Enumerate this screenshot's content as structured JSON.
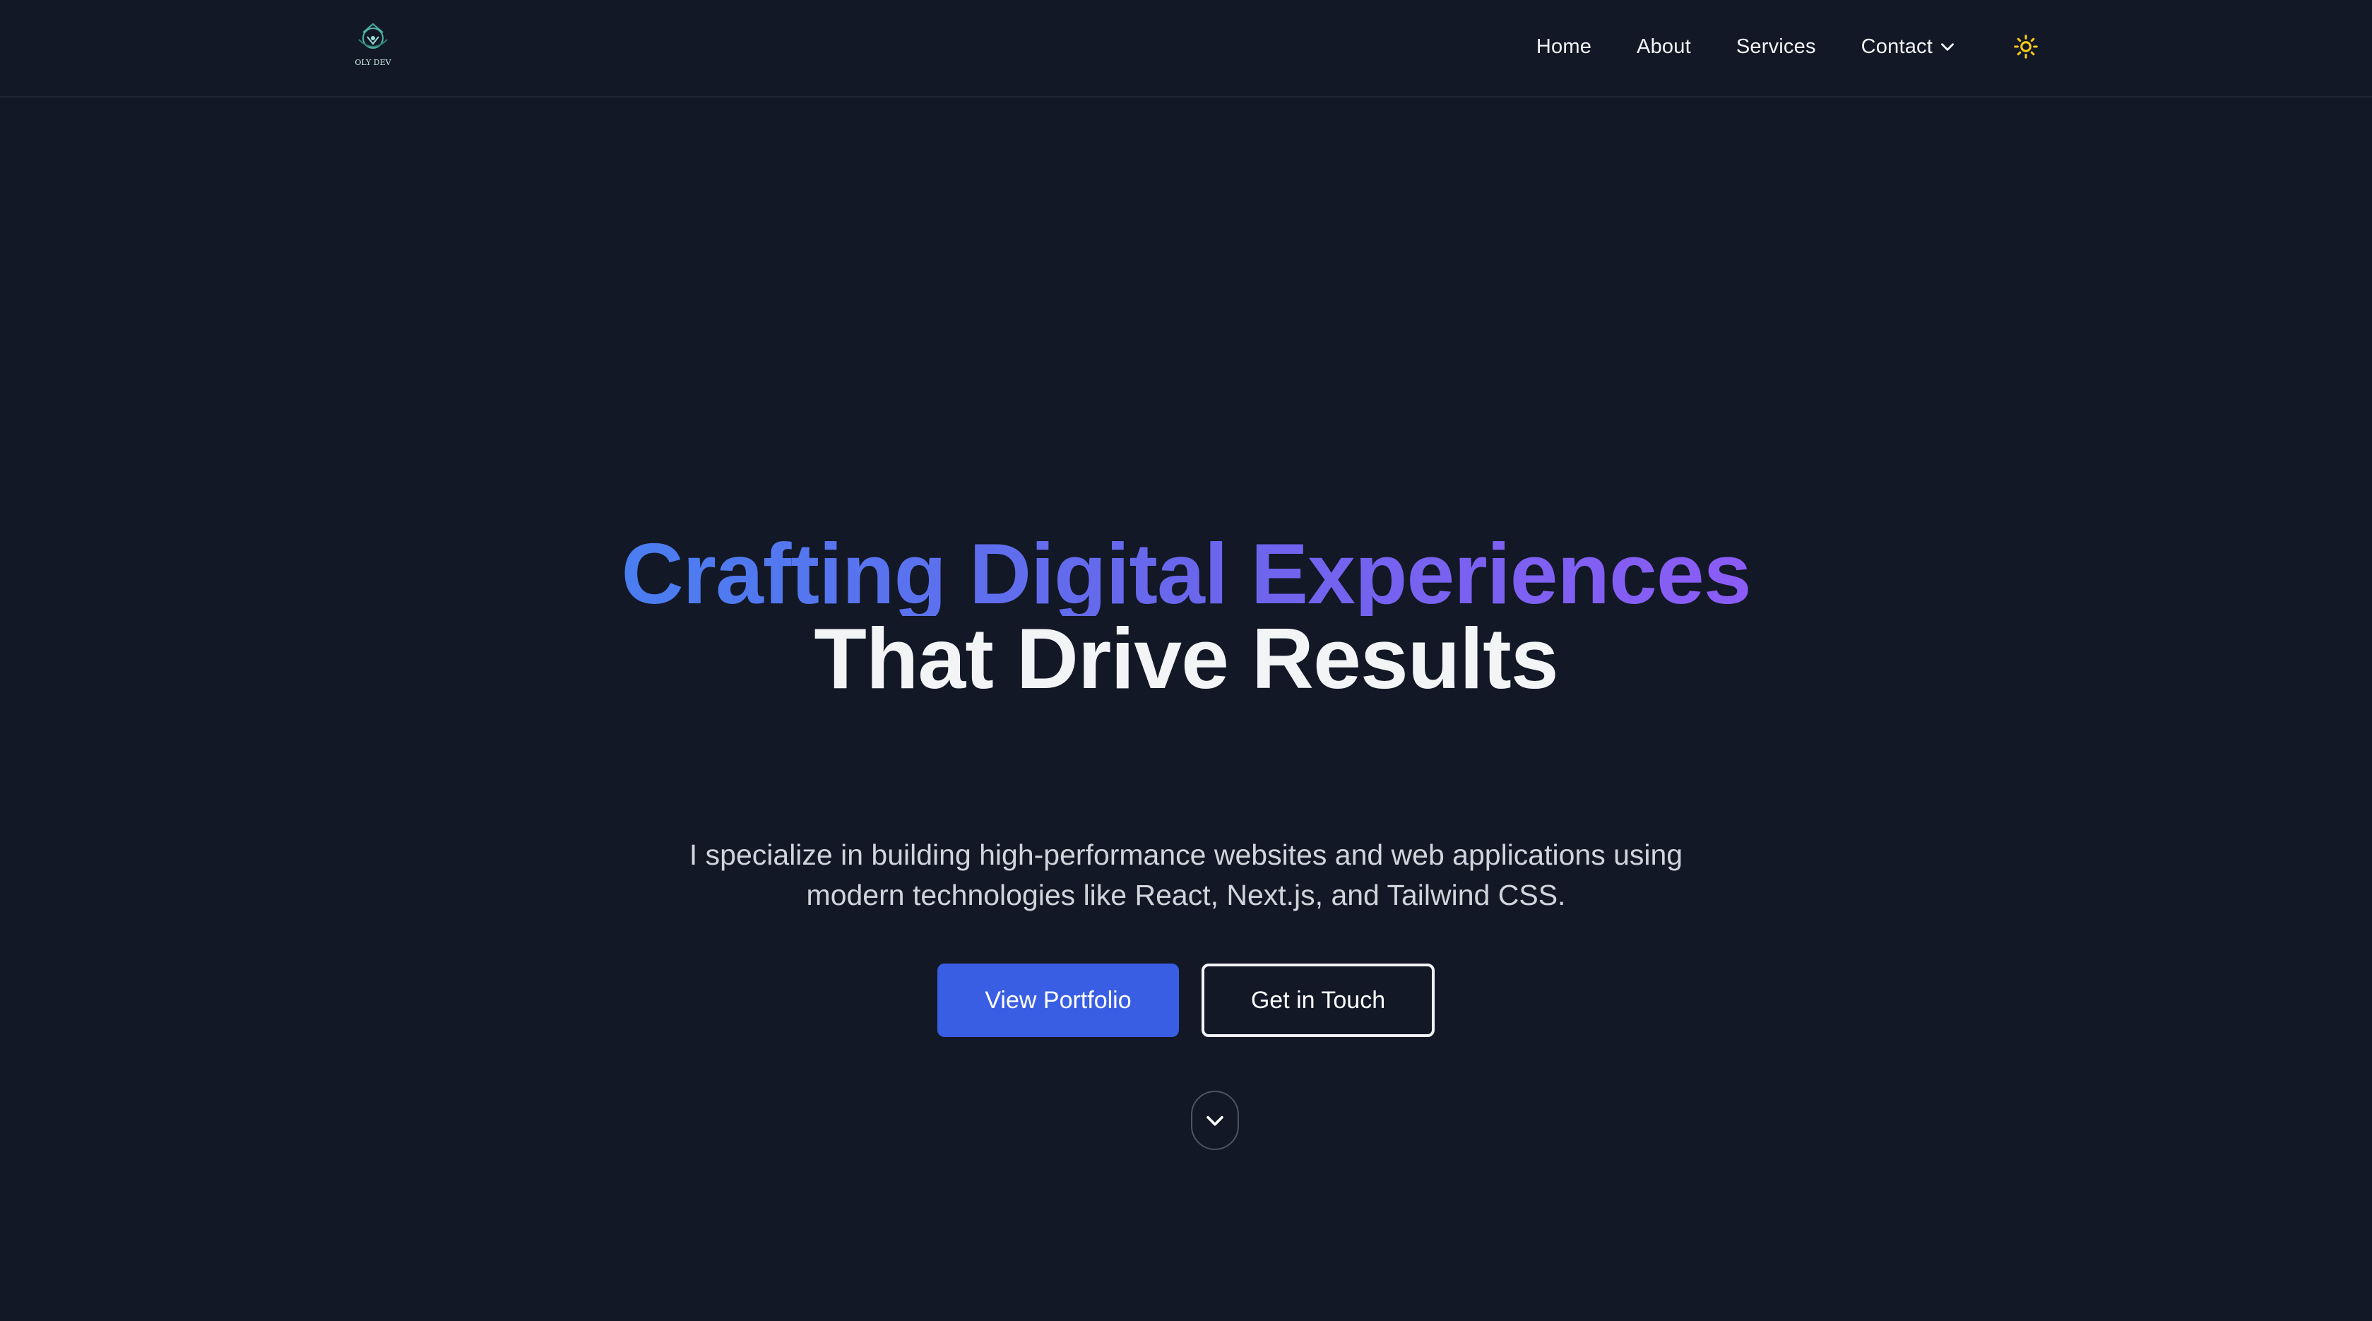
{
  "header": {
    "logo_text": "OLY DEV",
    "nav": {
      "home": "Home",
      "about": "About",
      "services": "Services",
      "contact": "Contact"
    },
    "theme_icon": "sun-icon"
  },
  "hero": {
    "headline_gradient": "Crafting Digital Experiences",
    "headline_white": "That Drive Results",
    "subtext_line1": "I specialize in building high-performance websites and web applications using",
    "subtext_line2": "modern technologies like React, Next.js, and Tailwind CSS.",
    "primary_button": "View Portfolio",
    "secondary_button": "Get in Touch",
    "scroll_icon": "chevron-down-icon"
  },
  "colors": {
    "background": "#121826",
    "primary": "#3a5ee3",
    "gradient_start": "#4a7ef0",
    "gradient_end": "#8b5cf6",
    "sun": "#facc15"
  }
}
